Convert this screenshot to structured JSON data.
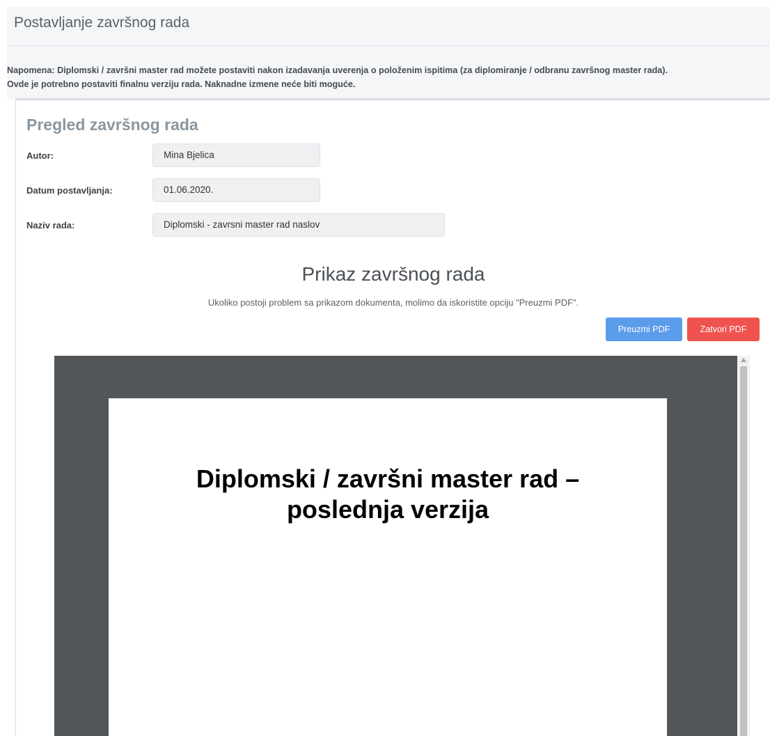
{
  "header": {
    "title": "Postavljanje završnog rada"
  },
  "note": {
    "line1": "Napomena: Diplomski / završni master rad možete postaviti nakon izadavanja uverenja o položenim ispitima (za diplomiranje / odbranu završnog master rada).",
    "line2": "Ovde je potrebno postaviti finalnu verziju rada. Naknadne izmene neće biti moguće."
  },
  "review": {
    "title": "Pregled završnog rada",
    "fields": [
      {
        "label": "Autor:",
        "value": "Mina Bjelica"
      },
      {
        "label": "Datum postavljanja:",
        "value": "01.06.2020."
      },
      {
        "label": "Naziv rada:",
        "value": "Diplomski - zavrsni master rad naslov"
      }
    ]
  },
  "preview": {
    "title": "Prikaz završnog rada",
    "subtitle": "Ukoliko postoji problem sa prikazom dokumenta, molimo da iskoristite opciju \"Preuzmi PDF\".",
    "download_label": "Preuzmi PDF",
    "close_label": "Zatvori PDF"
  },
  "pdf": {
    "heading_line1": "Diplomski / završni master rad –",
    "heading_line2": "poslednja verzija"
  },
  "colors": {
    "download_button": "#5b9ceb",
    "close_button": "#ef5350",
    "viewer_background": "#525659"
  },
  "icons": {
    "scroll_up": "triangle-up"
  }
}
